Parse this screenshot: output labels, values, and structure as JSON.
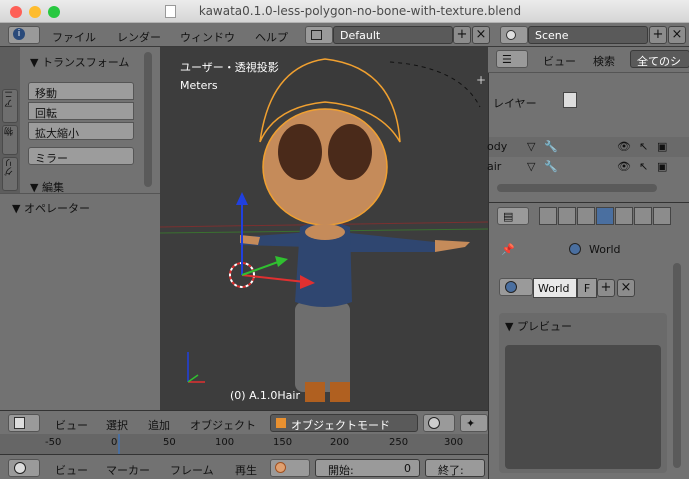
{
  "window": {
    "title": "kawata0.1.0-less-polygon-no-bone-with-texture.blend"
  },
  "info_header": {
    "menus": [
      "ファイル",
      "レンダー",
      "ウィンドウ",
      "ヘルプ"
    ],
    "screen_layout": "Default",
    "scene": "Scene"
  },
  "tool_shelf": {
    "tabs": [
      "アニ",
      "物",
      "グリ"
    ],
    "transform_panel": "▼ トランスフォーム",
    "buttons": [
      "移動",
      "回転",
      "拡大縮小"
    ],
    "mirror": "ミラー",
    "edit_panel": "▼ 編集",
    "operator_panel": "▼ オペレーター"
  },
  "viewport": {
    "view_label": "ユーザー・透視投影",
    "units": "Meters",
    "object_label": "(0) A.1.0Hair"
  },
  "viewport_header": {
    "menus": [
      "ビュー",
      "選択",
      "追加",
      "オブジェクト"
    ],
    "mode": "オブジェクトモード"
  },
  "timeline": {
    "ticks": [
      "-50",
      "0",
      "50",
      "100",
      "150",
      "200",
      "250",
      "300"
    ],
    "menus": [
      "ビュー",
      "マーカー",
      "フレーム",
      "再生"
    ],
    "start_label": "開始:",
    "start_value": "0",
    "end_label": "終了:"
  },
  "outliner": {
    "menus": [
      "ビュー",
      "検索"
    ],
    "filter": "全てのシ",
    "render_layers": "レイヤー",
    "rows": [
      "ody",
      "air"
    ]
  },
  "properties": {
    "breadcrumb": "World",
    "world_name": "World",
    "fake_user": "F",
    "preview_panel": "▼ プレビュー"
  },
  "colors": {
    "header": "#727272",
    "viewport_bg": "#3d3d3d",
    "selection_orange": "#f0a030",
    "axis_red": "#e03030",
    "axis_green": "#30c030",
    "axis_blue": "#2040e0"
  }
}
